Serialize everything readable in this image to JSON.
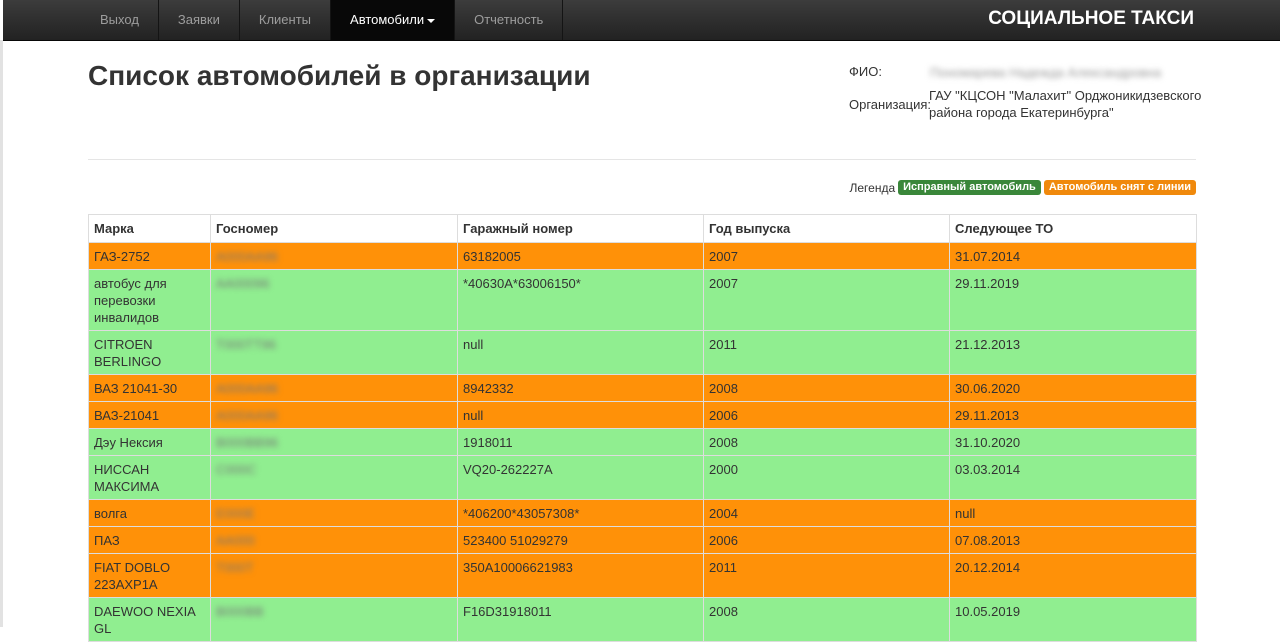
{
  "nav": {
    "items": [
      "Выход",
      "Заявки",
      "Клиенты",
      "Автомобили",
      "Отчетность"
    ],
    "active": "Автомобили",
    "brand": "СОЦИАЛЬНОЕ ТАКСИ"
  },
  "page": {
    "title": "Список автомобилей в организации"
  },
  "user": {
    "fio_label": "ФИО:",
    "fio_value": "Пономарева Надежда Александровна",
    "org_label": "Организация:",
    "org_line1": "ГАУ \"КЦСОН \"Малахит\" Орджоникидзевского",
    "org_line2": "района города Екатеринбурга\""
  },
  "legend": {
    "label": "Легенда",
    "ok_label": "Исправный автомобиль",
    "off_label": "Автомобиль снят с линии",
    "ok_color": "#3a873a",
    "off_color": "#f0890c"
  },
  "table": {
    "headers": [
      "Марка",
      "Госномер",
      "Гаражный номер",
      "Год выпуска",
      "Следующее ТО"
    ],
    "rows": [
      {
        "status": "off",
        "brand": "ГАЗ-2752",
        "plate": "А000АА96",
        "garage": "63182005",
        "year": "2007",
        "next": "31.07.2014"
      },
      {
        "status": "ok",
        "brand": "автобус для перевозки инвалидов",
        "plate": "АА00096",
        "garage": "*40630А*63006150*",
        "year": "2007",
        "next": "29.11.2019"
      },
      {
        "status": "ok",
        "brand": "CITROEN BERLINGO",
        "plate": "Т000ТТ96",
        "garage": "null",
        "year": "2011",
        "next": "21.12.2013"
      },
      {
        "status": "off",
        "brand": "ВАЗ 21041-30",
        "plate": "А000АА96",
        "garage": "8942332",
        "year": "2008",
        "next": "30.06.2020"
      },
      {
        "status": "off",
        "brand": "ВАЗ-21041",
        "plate": "А000АА96",
        "garage": "null",
        "year": "2006",
        "next": "29.11.2013"
      },
      {
        "status": "ok",
        "brand": "Дэу Нексия",
        "plate": "В000ВВ96",
        "garage": "1918011",
        "year": "2008",
        "next": "31.10.2020"
      },
      {
        "status": "ok",
        "brand": "НИССАН МАКСИМА",
        "plate": "С000С",
        "garage": "VQ20-262227A",
        "year": "2000",
        "next": "03.03.2014"
      },
      {
        "status": "off",
        "brand": "волга",
        "plate": "Е000Е",
        "garage": "*406200*43057308*",
        "year": "2004",
        "next": "null"
      },
      {
        "status": "off",
        "brand": "ПАЗ",
        "plate": "АА000",
        "garage": "523400 51029279",
        "year": "2006",
        "next": "07.08.2013"
      },
      {
        "status": "off",
        "brand": "FIAT DOBLO 223AXP1A",
        "plate": "Т000Т",
        "garage": "350A10006621983",
        "year": "2011",
        "next": "20.12.2014"
      },
      {
        "status": "ok",
        "brand": "DAEWOO NEXIA GL",
        "plate": "В000ВВ",
        "garage": "F16D31918011",
        "year": "2008",
        "next": "10.05.2019"
      }
    ]
  }
}
